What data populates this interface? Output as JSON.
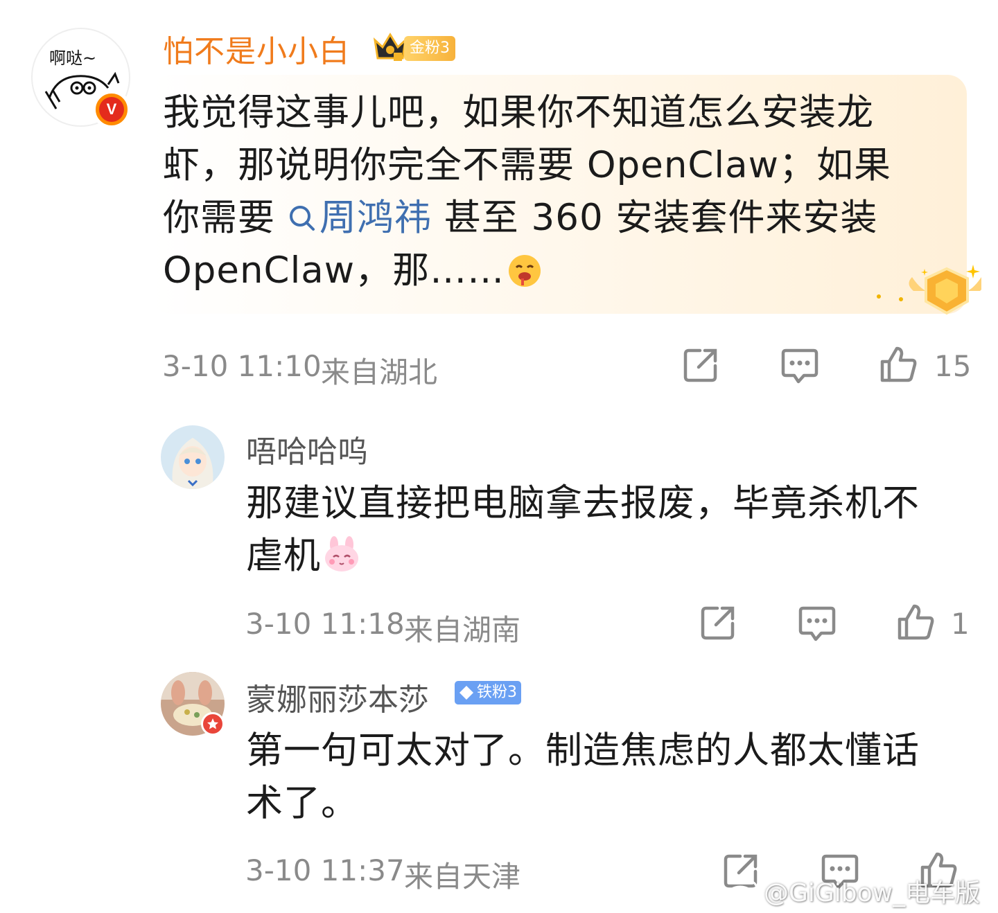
{
  "main_comment": {
    "avatar_text": "啊哒~",
    "author": "怕不是小小白",
    "fan_badge": "金粉3",
    "text_before_topic": "我觉得这事儿吧，如果你不知道怎么安装龙虾，那说明你完全不需要 OpenClaw；如果你需要",
    "topic": "周鸿祎",
    "text_after_topic": " 甚至 360 安装套件来安装 OpenClaw，那……",
    "time": "3-10 11:10",
    "location": "来自湖北",
    "likes": "15"
  },
  "replies": [
    {
      "author": "唔哈哈呜",
      "text": "那建议直接把电脑拿去报废，毕竟杀机不虐机",
      "time": "3-10 11:18",
      "location": "来自湖南",
      "likes": "1"
    },
    {
      "author": "蒙娜丽莎本莎",
      "fan_badge": "铁粉3",
      "text": "第一句可太对了。制造焦虑的人都太懂话术了。",
      "time": "3-10 11:37",
      "location": "来自天津",
      "likes": ""
    }
  ],
  "watermark": "@GiGibow_电车版",
  "colors": {
    "author_orange": "#f07b1c",
    "topic_blue": "#3f6fb0",
    "meta_gray": "#8a8a8a",
    "iron_badge": "#6aa0f3"
  }
}
